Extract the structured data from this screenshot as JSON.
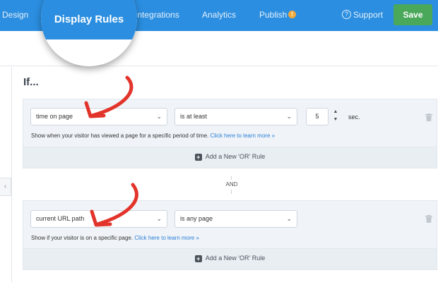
{
  "nav": {
    "design": "Design",
    "display_rules": "Display Rules",
    "integrations": "Integrations",
    "analytics": "Analytics",
    "publish": "Publish",
    "publish_badge": "!",
    "support": "Support",
    "save": "Save"
  },
  "heading": "If...",
  "rule1": {
    "condition": "time on page",
    "operator": "is at least",
    "value": "5",
    "unit": "sec.",
    "help": "Show when your visitor has viewed a page for a specific period of time.",
    "help_link": "Click here to learn more »",
    "add_or": "Add a New 'OR' Rule"
  },
  "and_label": "AND",
  "rule2": {
    "condition": "current URL path",
    "operator": "is any page",
    "help": "Show if your visitor is on a specific page.",
    "help_link": "Click here to learn more »",
    "add_or": "Add a New 'OR' Rule"
  },
  "colors": {
    "nav_blue": "#2b8ee0",
    "save_green": "#4aa85a",
    "arrow_red": "#e2342b",
    "link_blue": "#2b7ed6"
  }
}
